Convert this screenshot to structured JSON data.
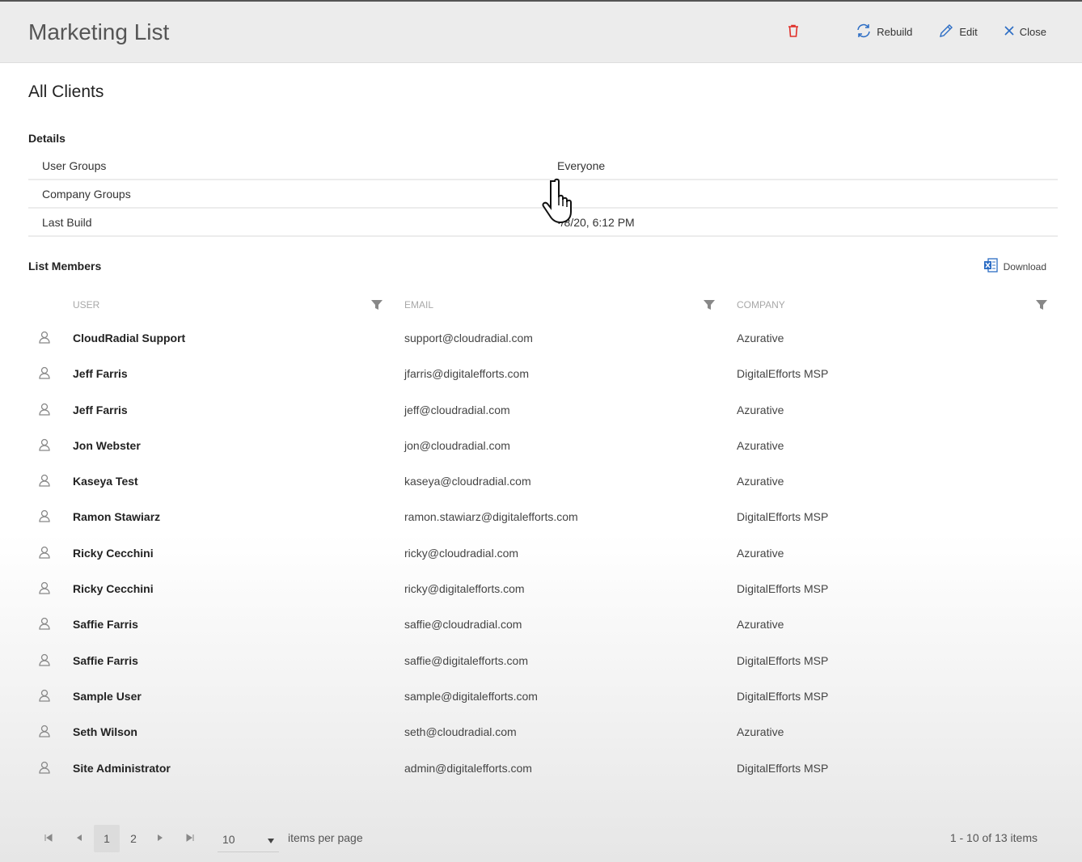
{
  "window": {
    "title": "Marketing List",
    "actions": {
      "delete_icon": "trash-icon",
      "rebuild_label": "Rebuild",
      "edit_label": "Edit",
      "close_label": "Close"
    }
  },
  "page": {
    "heading": "All Clients",
    "details_label": "Details",
    "details": [
      {
        "key": "User Groups",
        "value": "Everyone"
      },
      {
        "key": "Company Groups",
        "value": ""
      },
      {
        "key": "Last Build",
        "value": "·/8/20, 6:12 PM"
      }
    ],
    "list_members_label": "List Members",
    "download_label": "Download"
  },
  "grid": {
    "columns": [
      "USER",
      "EMAIL",
      "COMPANY"
    ],
    "rows": [
      {
        "user": "CloudRadial Support",
        "email": "support@cloudradial.com",
        "company": "Azurative"
      },
      {
        "user": "Jeff Farris",
        "email": "jfarris@digitalefforts.com",
        "company": "DigitalEfforts MSP"
      },
      {
        "user": "Jeff Farris",
        "email": "jeff@cloudradial.com",
        "company": "Azurative"
      },
      {
        "user": "Jon Webster",
        "email": "jon@cloudradial.com",
        "company": "Azurative"
      },
      {
        "user": "Kaseya Test",
        "email": "kaseya@cloudradial.com",
        "company": "Azurative"
      },
      {
        "user": "Ramon Stawiarz",
        "email": "ramon.stawiarz@digitalefforts.com",
        "company": "DigitalEfforts MSP"
      },
      {
        "user": "Ricky Cecchini",
        "email": "ricky@cloudradial.com",
        "company": "Azurative"
      },
      {
        "user": "Ricky Cecchini",
        "email": "ricky@digitalefforts.com",
        "company": "DigitalEfforts MSP"
      },
      {
        "user": "Saffie Farris",
        "email": "saffie@cloudradial.com",
        "company": "Azurative"
      },
      {
        "user": "Saffie Farris",
        "email": "saffie@digitalefforts.com",
        "company": "DigitalEfforts MSP"
      },
      {
        "user": "Sample User",
        "email": "sample@digitalefforts.com",
        "company": "DigitalEfforts MSP"
      },
      {
        "user": "Seth Wilson",
        "email": "seth@cloudradial.com",
        "company": "Azurative"
      },
      {
        "user": "Site Administrator",
        "email": "admin@digitalefforts.com",
        "company": "DigitalEfforts MSP"
      }
    ]
  },
  "pager": {
    "pages": [
      "1",
      "2"
    ],
    "current_page": "1",
    "page_size": "10",
    "items_per_page_label": "items per page",
    "info": "1 - 10 of 13 items"
  },
  "colors": {
    "header_bg": "#ececec",
    "delete_red": "#e0302a",
    "action_blue": "#2b6cc4"
  }
}
